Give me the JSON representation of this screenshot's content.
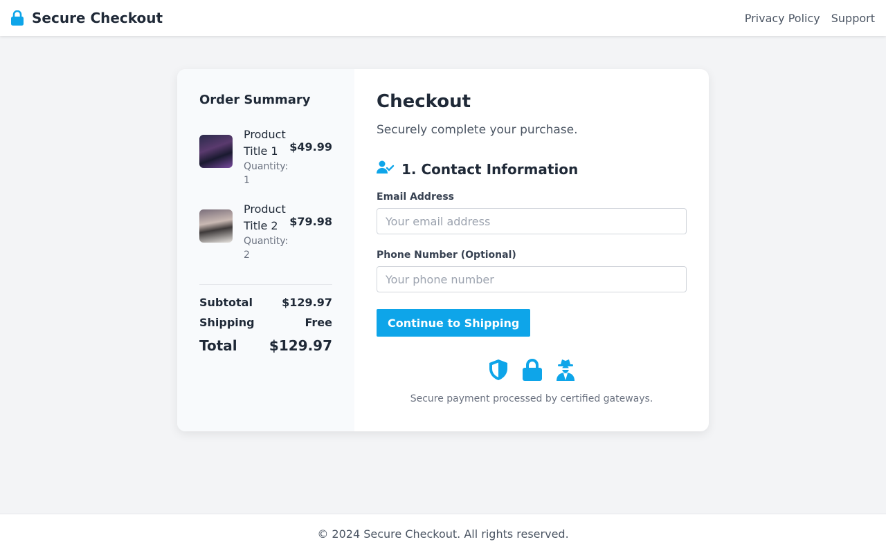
{
  "header": {
    "icon": "lock-icon",
    "title": "Secure Checkout",
    "links": [
      "Privacy Policy",
      "Support"
    ]
  },
  "summary": {
    "title": "Order Summary",
    "items": [
      {
        "name": "Product Title 1",
        "quantity": "Quantity: 1",
        "price": "$49.99"
      },
      {
        "name": "Product Title 2",
        "quantity": "Quantity: 2",
        "price": "$79.98"
      }
    ],
    "subtotal_label": "Subtotal",
    "subtotal_value": "$129.97",
    "shipping_label": "Shipping",
    "shipping_value": "Free",
    "total_label": "Total",
    "total_value": "$129.97"
  },
  "checkout": {
    "title": "Checkout",
    "subtitle": "Securely complete your purchase.",
    "section_icon": "user-check-icon",
    "section_title": "1. Contact Information",
    "email_label": "Email Address",
    "email_placeholder": "Your email address",
    "email_value": "",
    "phone_label": "Phone Number (Optional)",
    "phone_placeholder": "Your phone number",
    "phone_value": "",
    "continue_label": "Continue to Shipping",
    "trust_icons": [
      "shield-icon",
      "lock-icon",
      "user-secret-icon"
    ],
    "trust_text": "Secure payment processed by certified gateways."
  },
  "footer": {
    "text": "© 2024 Secure Checkout. All rights reserved."
  },
  "colors": {
    "accent": "#0ea5e9",
    "background": "#f3f4f6",
    "text": "#1f2937"
  }
}
